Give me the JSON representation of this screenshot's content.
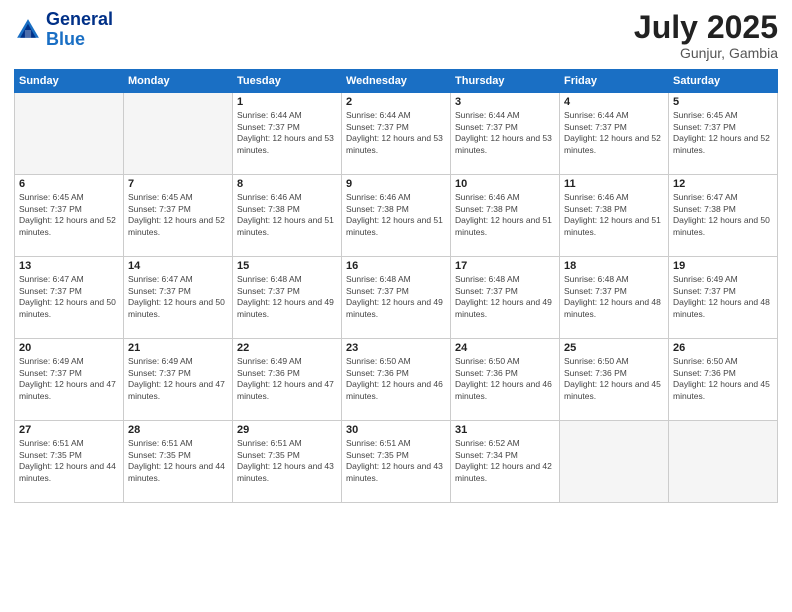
{
  "header": {
    "logo_line1": "General",
    "logo_line2": "Blue",
    "month_year": "July 2025",
    "location": "Gunjur, Gambia"
  },
  "weekdays": [
    "Sunday",
    "Monday",
    "Tuesday",
    "Wednesday",
    "Thursday",
    "Friday",
    "Saturday"
  ],
  "weeks": [
    [
      {
        "day": "",
        "info": ""
      },
      {
        "day": "",
        "info": ""
      },
      {
        "day": "1",
        "info": "Sunrise: 6:44 AM\nSunset: 7:37 PM\nDaylight: 12 hours and 53 minutes."
      },
      {
        "day": "2",
        "info": "Sunrise: 6:44 AM\nSunset: 7:37 PM\nDaylight: 12 hours and 53 minutes."
      },
      {
        "day": "3",
        "info": "Sunrise: 6:44 AM\nSunset: 7:37 PM\nDaylight: 12 hours and 53 minutes."
      },
      {
        "day": "4",
        "info": "Sunrise: 6:44 AM\nSunset: 7:37 PM\nDaylight: 12 hours and 52 minutes."
      },
      {
        "day": "5",
        "info": "Sunrise: 6:45 AM\nSunset: 7:37 PM\nDaylight: 12 hours and 52 minutes."
      }
    ],
    [
      {
        "day": "6",
        "info": "Sunrise: 6:45 AM\nSunset: 7:37 PM\nDaylight: 12 hours and 52 minutes."
      },
      {
        "day": "7",
        "info": "Sunrise: 6:45 AM\nSunset: 7:37 PM\nDaylight: 12 hours and 52 minutes."
      },
      {
        "day": "8",
        "info": "Sunrise: 6:46 AM\nSunset: 7:38 PM\nDaylight: 12 hours and 51 minutes."
      },
      {
        "day": "9",
        "info": "Sunrise: 6:46 AM\nSunset: 7:38 PM\nDaylight: 12 hours and 51 minutes."
      },
      {
        "day": "10",
        "info": "Sunrise: 6:46 AM\nSunset: 7:38 PM\nDaylight: 12 hours and 51 minutes."
      },
      {
        "day": "11",
        "info": "Sunrise: 6:46 AM\nSunset: 7:38 PM\nDaylight: 12 hours and 51 minutes."
      },
      {
        "day": "12",
        "info": "Sunrise: 6:47 AM\nSunset: 7:38 PM\nDaylight: 12 hours and 50 minutes."
      }
    ],
    [
      {
        "day": "13",
        "info": "Sunrise: 6:47 AM\nSunset: 7:37 PM\nDaylight: 12 hours and 50 minutes."
      },
      {
        "day": "14",
        "info": "Sunrise: 6:47 AM\nSunset: 7:37 PM\nDaylight: 12 hours and 50 minutes."
      },
      {
        "day": "15",
        "info": "Sunrise: 6:48 AM\nSunset: 7:37 PM\nDaylight: 12 hours and 49 minutes."
      },
      {
        "day": "16",
        "info": "Sunrise: 6:48 AM\nSunset: 7:37 PM\nDaylight: 12 hours and 49 minutes."
      },
      {
        "day": "17",
        "info": "Sunrise: 6:48 AM\nSunset: 7:37 PM\nDaylight: 12 hours and 49 minutes."
      },
      {
        "day": "18",
        "info": "Sunrise: 6:48 AM\nSunset: 7:37 PM\nDaylight: 12 hours and 48 minutes."
      },
      {
        "day": "19",
        "info": "Sunrise: 6:49 AM\nSunset: 7:37 PM\nDaylight: 12 hours and 48 minutes."
      }
    ],
    [
      {
        "day": "20",
        "info": "Sunrise: 6:49 AM\nSunset: 7:37 PM\nDaylight: 12 hours and 47 minutes."
      },
      {
        "day": "21",
        "info": "Sunrise: 6:49 AM\nSunset: 7:37 PM\nDaylight: 12 hours and 47 minutes."
      },
      {
        "day": "22",
        "info": "Sunrise: 6:49 AM\nSunset: 7:36 PM\nDaylight: 12 hours and 47 minutes."
      },
      {
        "day": "23",
        "info": "Sunrise: 6:50 AM\nSunset: 7:36 PM\nDaylight: 12 hours and 46 minutes."
      },
      {
        "day": "24",
        "info": "Sunrise: 6:50 AM\nSunset: 7:36 PM\nDaylight: 12 hours and 46 minutes."
      },
      {
        "day": "25",
        "info": "Sunrise: 6:50 AM\nSunset: 7:36 PM\nDaylight: 12 hours and 45 minutes."
      },
      {
        "day": "26",
        "info": "Sunrise: 6:50 AM\nSunset: 7:36 PM\nDaylight: 12 hours and 45 minutes."
      }
    ],
    [
      {
        "day": "27",
        "info": "Sunrise: 6:51 AM\nSunset: 7:35 PM\nDaylight: 12 hours and 44 minutes."
      },
      {
        "day": "28",
        "info": "Sunrise: 6:51 AM\nSunset: 7:35 PM\nDaylight: 12 hours and 44 minutes."
      },
      {
        "day": "29",
        "info": "Sunrise: 6:51 AM\nSunset: 7:35 PM\nDaylight: 12 hours and 43 minutes."
      },
      {
        "day": "30",
        "info": "Sunrise: 6:51 AM\nSunset: 7:35 PM\nDaylight: 12 hours and 43 minutes."
      },
      {
        "day": "31",
        "info": "Sunrise: 6:52 AM\nSunset: 7:34 PM\nDaylight: 12 hours and 42 minutes."
      },
      {
        "day": "",
        "info": ""
      },
      {
        "day": "",
        "info": ""
      }
    ]
  ]
}
